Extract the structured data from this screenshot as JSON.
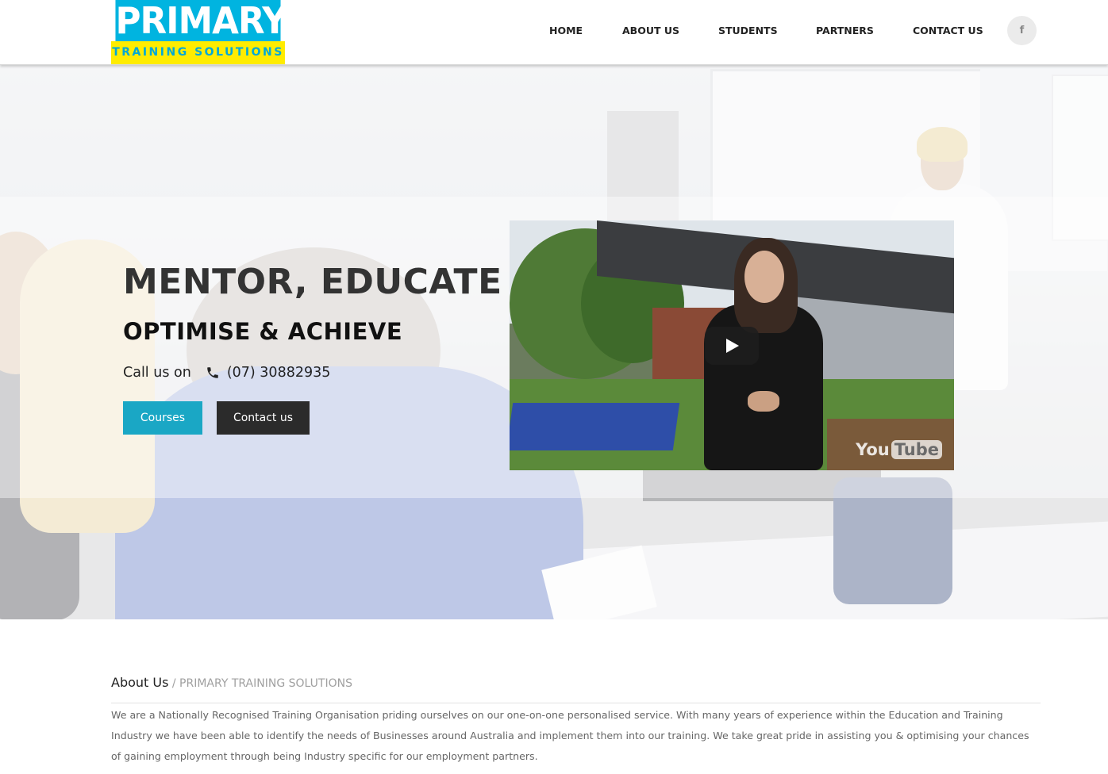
{
  "logo": {
    "primary": "PRIMARY",
    "tagline": "TRAINING  SOLUTIONS"
  },
  "nav": {
    "items": [
      {
        "label": "HOME"
      },
      {
        "label": "ABOUT US"
      },
      {
        "label": "STUDENTS"
      },
      {
        "label": "PARTNERS"
      },
      {
        "label": "CONTACT US"
      }
    ],
    "facebook_glyph": "f"
  },
  "hero": {
    "headline": "MENTOR, EDUCATE",
    "subheadline": "OPTIMISE & ACHIEVE",
    "call_prefix": "Call us on",
    "phone": "(07) 30882935",
    "courses_button": "Courses",
    "contact_button": "Contact us"
  },
  "video": {
    "brand_you": "You",
    "brand_tube": "Tube"
  },
  "about": {
    "title": "About Us",
    "subtitle": " / PRIMARY TRAINING SOLUTIONS",
    "body": "We are a Nationally Recognised Training Organisation priding ourselves on our one-on-one personalised service. With many years of experience within the Education and Training Industry we have been able to identify the needs of Businesses around Australia and implement them into our training. We take great pride in assisting you & optimising your chances of gaining employment through being Industry specific for our employment partners."
  },
  "colors": {
    "brand_cyan": "#00b4e0",
    "brand_yellow": "#ffec00",
    "courses_button": "#1aa7c5",
    "contact_button": "#2b2b2b"
  },
  "icons": [
    "facebook-icon",
    "phone-icon",
    "play-icon",
    "youtube-logo"
  ]
}
